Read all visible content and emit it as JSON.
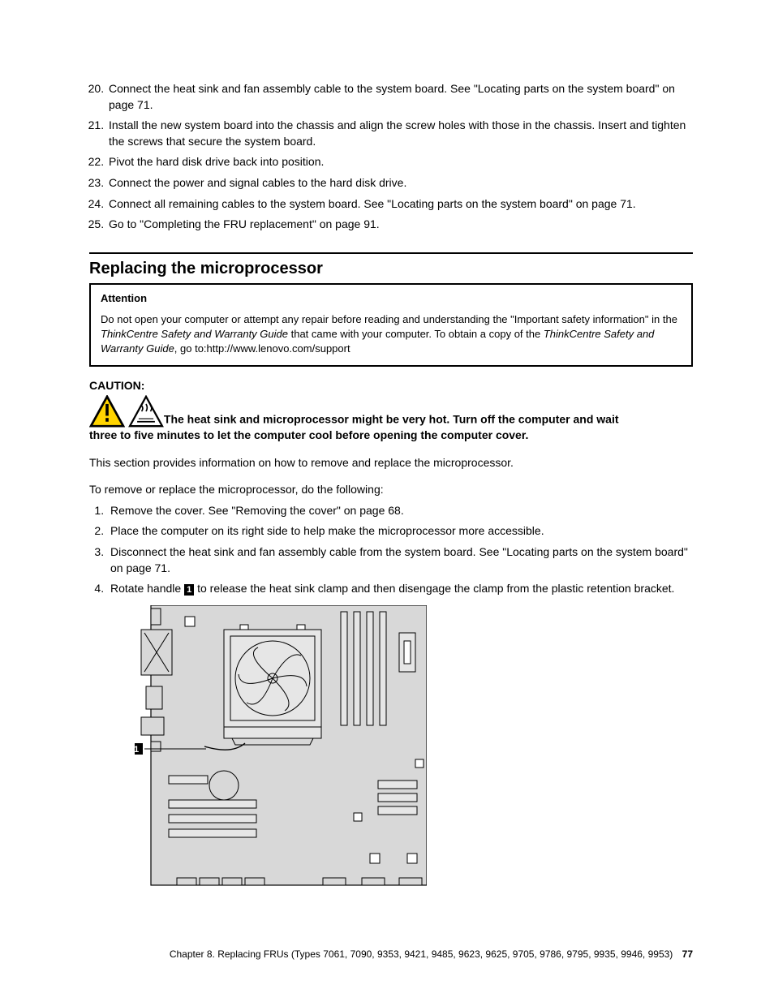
{
  "topList": {
    "start": 20,
    "items": [
      "Connect the heat sink and fan assembly cable to the system board. See \"Locating parts on the system board\" on page 71.",
      "Install the new system board into the chassis and align the screw holes with those in the chassis. Insert and tighten the screws that secure the system board.",
      "Pivot the hard disk drive back into position.",
      "Connect the power and signal cables to the hard disk drive.",
      "Connect all remaining cables to the system board. See \"Locating parts on the system board\" on page 71.",
      "Go to \"Completing the FRU replacement\" on page 91."
    ]
  },
  "section": {
    "title": "Replacing the microprocessor"
  },
  "attention": {
    "title": "Attention",
    "text_pre": "Do not open your computer or attempt any repair before reading and understanding the \"Important safety information\" in the ",
    "italic1": "ThinkCentre Safety and Warranty Guide",
    "text_mid": " that came with your computer. To obtain a copy of the ",
    "italic2": "ThinkCentre Safety and Warranty Guide",
    "text_post": ", go to:http://www.lenovo.com/support"
  },
  "caution": {
    "label": "CAUTION:",
    "line1": "The heat sink and microprocessor might be very hot. Turn off the computer and wait ",
    "line2": "three to five minutes to let the computer cool before opening the computer cover."
  },
  "body": {
    "p1": "This section provides information on how to remove and replace the microprocessor.",
    "p2": "To remove or replace the microprocessor, do the following:"
  },
  "steps": [
    "Remove the cover. See \"Removing the cover\" on page 68.",
    "Place the computer on its right side to help make the microprocessor more accessible.",
    "Disconnect the heat sink and fan assembly cable from the system board. See \"Locating parts on the system board\" on page 71."
  ],
  "step4": {
    "pre": "Rotate handle ",
    "callout": "1",
    "post": " to release the heat sink clamp and then disengage the clamp from the plastic retention bracket."
  },
  "figure": {
    "callout": "1"
  },
  "footer": {
    "text": "Chapter 8. Replacing FRUs (Types 7061, 7090, 9353, 9421, 9485, 9623, 9625, 9705, 9786, 9795, 9935, 9946, 9953)",
    "page": "77"
  }
}
